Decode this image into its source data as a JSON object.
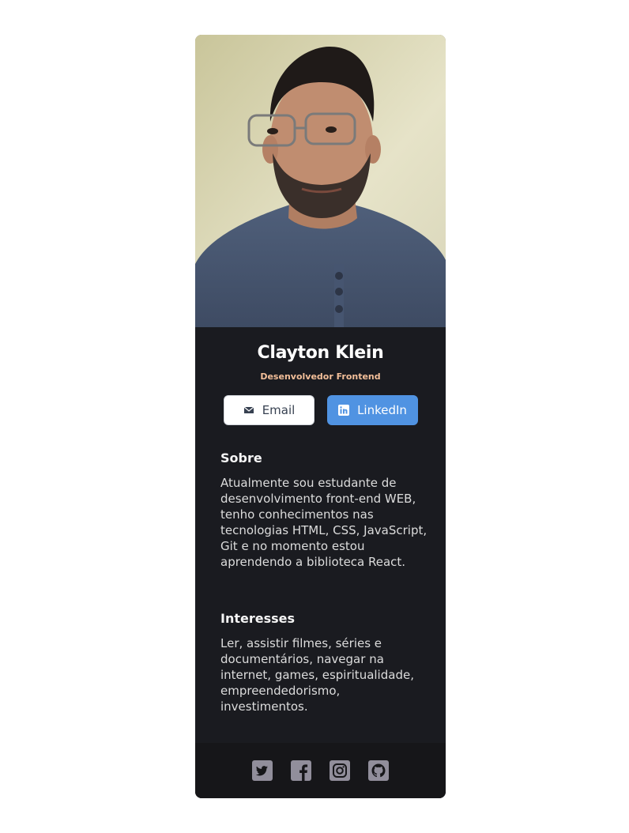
{
  "profile": {
    "name": "Clayton Klein",
    "role": "Desenvolvedor Frontend",
    "photo_icon": "portrait-photo"
  },
  "buttons": {
    "email_label": "Email",
    "email_icon": "envelope-icon",
    "linkedin_label": "LinkedIn",
    "linkedin_icon": "linkedin-icon",
    "linkedin_color": "#5093e2"
  },
  "about": {
    "title": "Sobre",
    "text": "Atualmente sou estudante de desenvolvimento front-end WEB, tenho conhecimentos nas tecnologias HTML, CSS, JavaScript, Git e no momento estou aprendendo a biblioteca React."
  },
  "interests": {
    "title": "Interesses",
    "text": "Ler, assistir filmes, séries e documentários, navegar na internet, games, espiritualidade, empreendedorismo, investimentos."
  },
  "footer": {
    "icons": [
      "twitter-icon",
      "facebook-icon",
      "instagram-icon",
      "github-icon"
    ],
    "icon_color": "#918e9b"
  },
  "colors": {
    "card_bg": "#1a1b20",
    "footer_bg": "#161619",
    "accent": "#f3bf99"
  }
}
